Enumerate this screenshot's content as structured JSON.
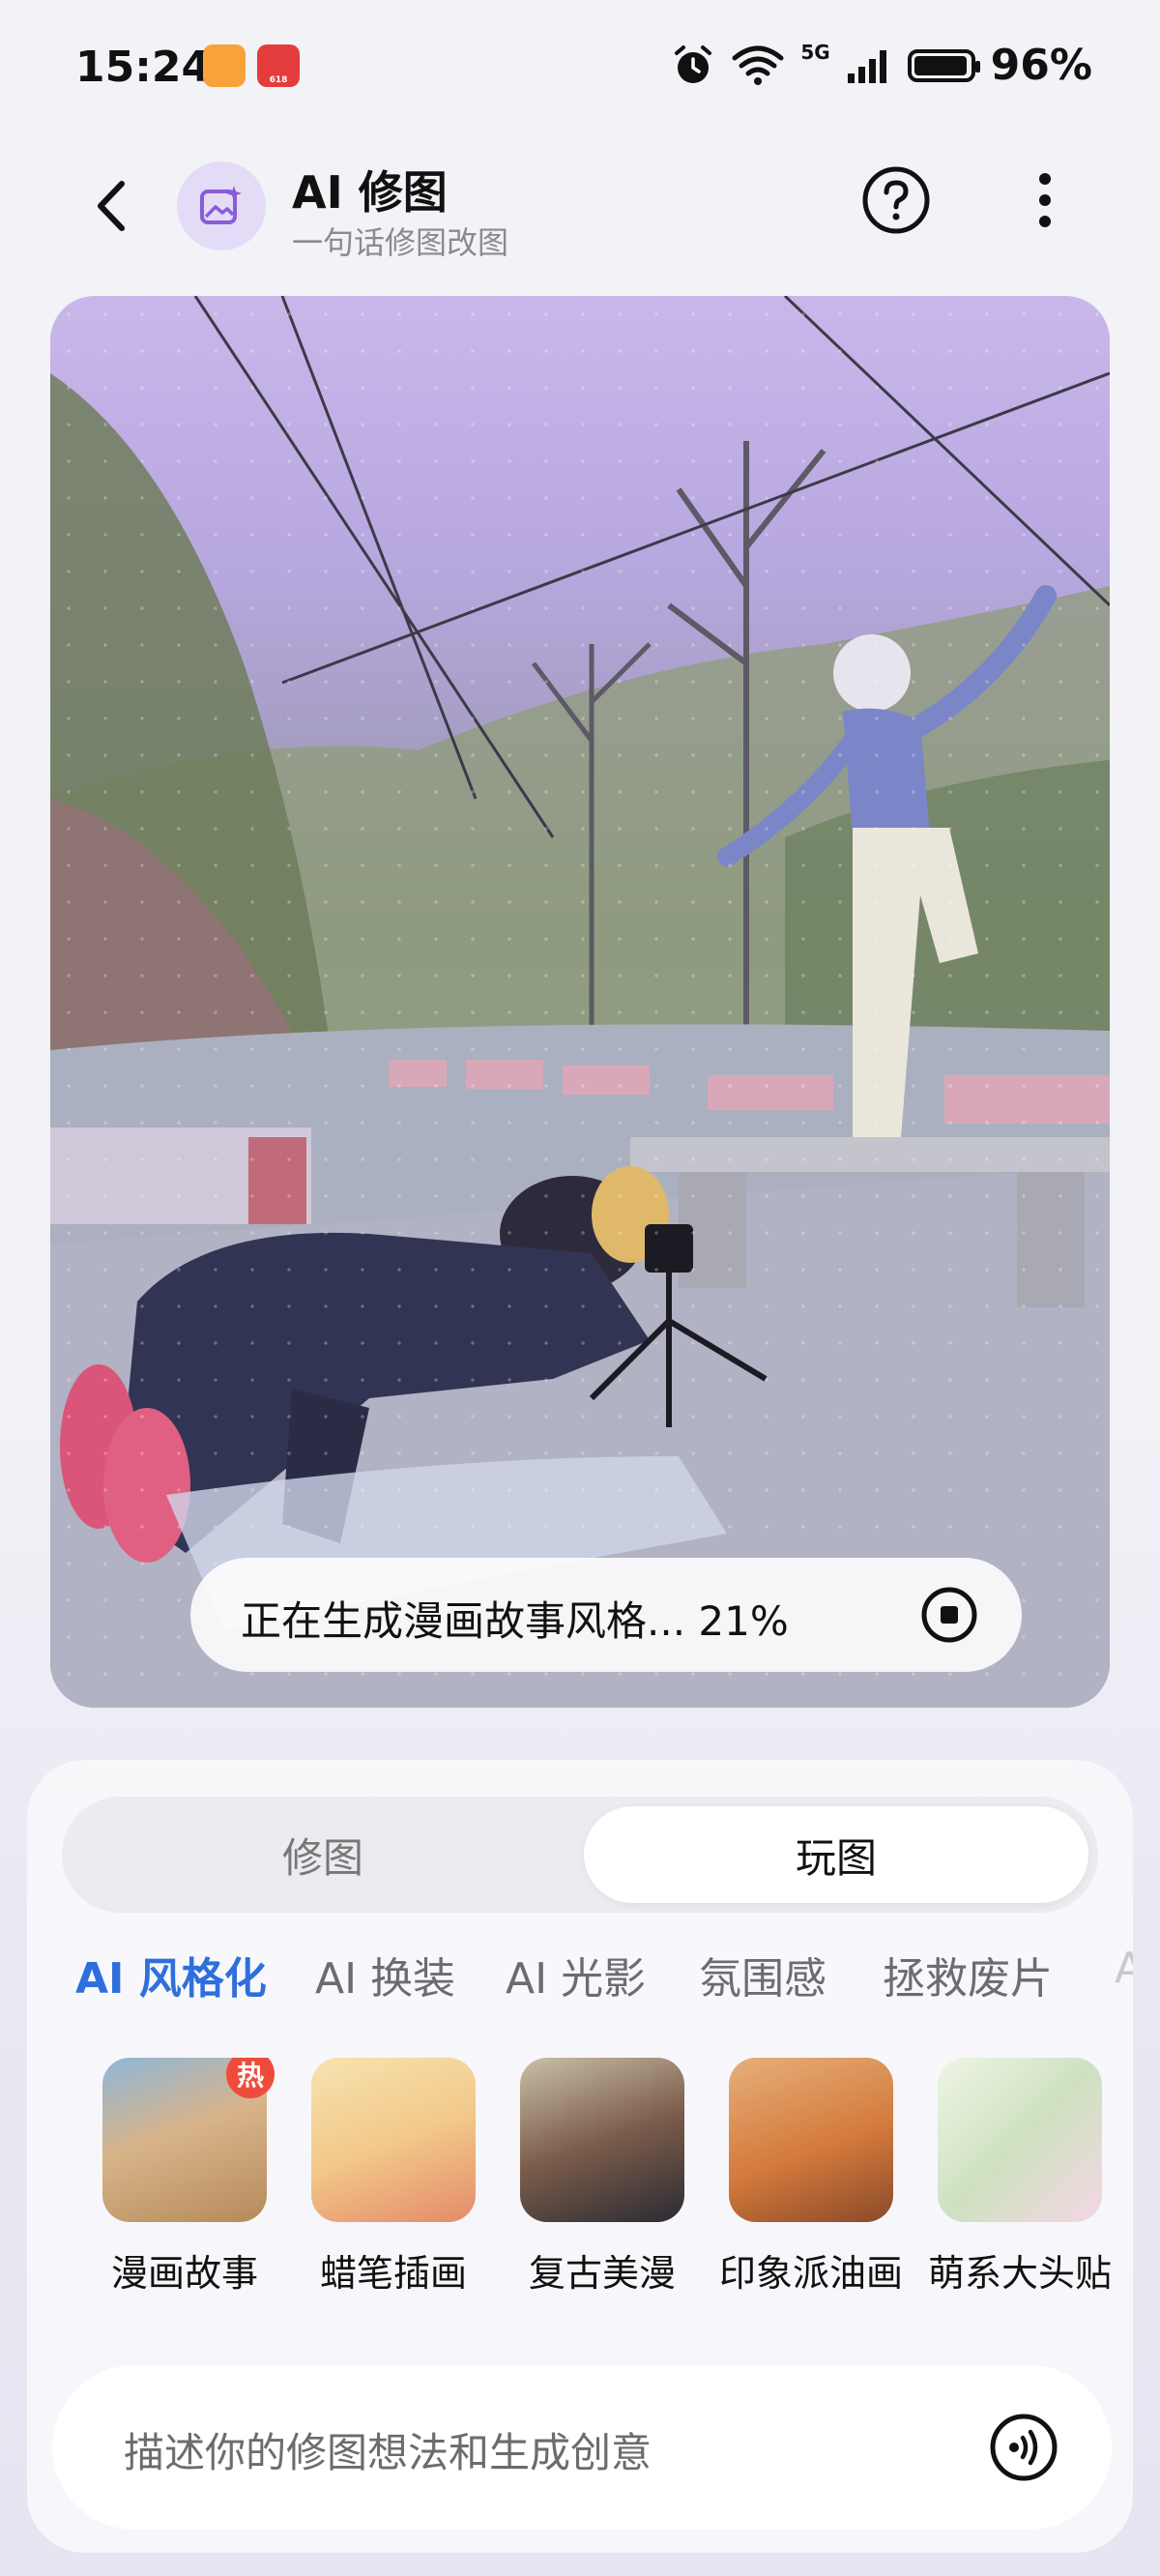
{
  "status_bar": {
    "time": "15:24",
    "signal_label": "5G",
    "battery_percent": "96%"
  },
  "header": {
    "title": "AI 修图",
    "subtitle": "一句话修图改图"
  },
  "progress": {
    "text": "正在生成漫画故事风格... 21%",
    "value": 0.21
  },
  "segments": [
    {
      "label": "修图",
      "selected": false
    },
    {
      "label": "玩图",
      "selected": true
    }
  ],
  "categories": [
    {
      "label": "AI 风格化",
      "active": true
    },
    {
      "label": "AI 换装",
      "active": false
    },
    {
      "label": "AI 光影",
      "active": false
    },
    {
      "label": "氛围感",
      "active": false
    },
    {
      "label": "拯救废片",
      "active": false
    },
    {
      "label": "A",
      "active": false
    }
  ],
  "styles": [
    {
      "label": "漫画故事",
      "badge": "热",
      "color": "#d8b48a"
    },
    {
      "label": "蜡笔插画",
      "badge": "",
      "color": "#f2c98a"
    },
    {
      "label": "复古美漫",
      "badge": "",
      "color": "#7c5d4b"
    },
    {
      "label": "印象派油画",
      "badge": "",
      "color": "#d47a3c"
    },
    {
      "label": "萌系大头贴",
      "badge": "",
      "color": "#cfe1c0"
    },
    {
      "label": "",
      "badge": "",
      "color": "#e6d3a8"
    }
  ],
  "input": {
    "placeholder": "描述你的修图想法和生成创意"
  },
  "colors": {
    "accent_blue": "#2f6fdc",
    "icon_purple": "#8a5cd8",
    "hot_red": "#f04b3a"
  }
}
